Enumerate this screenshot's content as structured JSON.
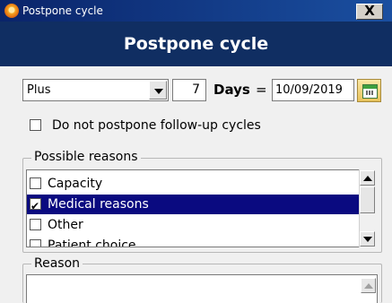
{
  "window": {
    "title": "Postpone cycle",
    "icon": "app-icon",
    "close_glyph": "X"
  },
  "header": {
    "title": "Postpone cycle"
  },
  "controls": {
    "mode_select": {
      "value": "Plus"
    },
    "days_input": {
      "value": "7"
    },
    "days_label": "Days",
    "equals": "=",
    "date_input": {
      "value": "10/09/2019"
    },
    "postpone_checkbox": {
      "label": "Do not postpone follow-up cycles",
      "checked": false
    }
  },
  "possible_reasons": {
    "legend": "Possible reasons",
    "items": [
      {
        "label": "Capacity",
        "checked": false,
        "selected": false
      },
      {
        "label": "Medical reasons",
        "checked": true,
        "selected": true
      },
      {
        "label": "Other",
        "checked": false,
        "selected": false
      },
      {
        "label": "Patient choice",
        "checked": false,
        "selected": false
      }
    ]
  },
  "reason": {
    "legend": "Reason",
    "value": ""
  },
  "colors": {
    "banner": "#102e62",
    "selection": "#0a0a80"
  }
}
